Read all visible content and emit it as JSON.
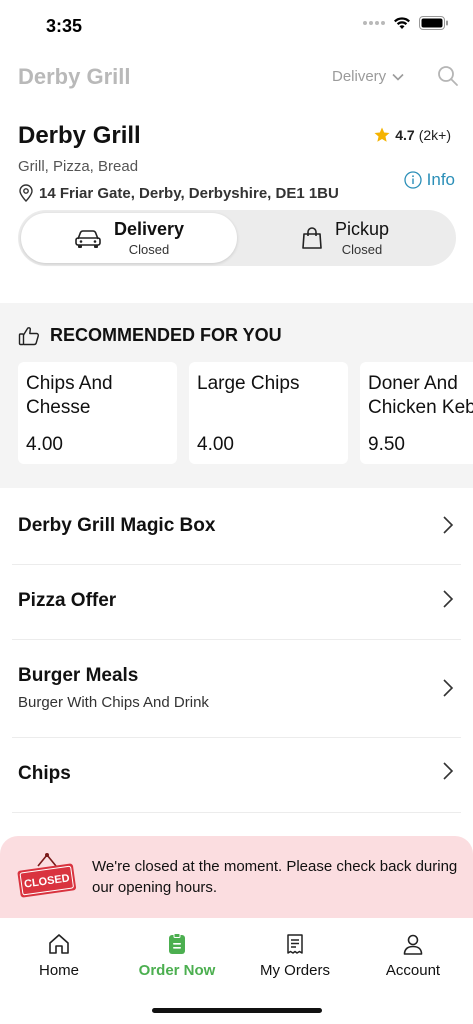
{
  "status_bar": {
    "time": "3:35"
  },
  "top_nav": {
    "title": "Derby Grill",
    "mode": "Delivery"
  },
  "restaurant": {
    "name": "Derby Grill",
    "rating": "4.7",
    "rating_count": "(2k+)",
    "cuisine": "Grill, Pizza, Bread",
    "address": "14 Friar Gate, Derby, Derbyshire, DE1 1BU",
    "info_label": "Info"
  },
  "order_mode": {
    "delivery": {
      "label": "Delivery",
      "status": "Closed"
    },
    "pickup": {
      "label": "Pickup",
      "status": "Closed"
    }
  },
  "recommended": {
    "title": "RECOMMENDED FOR YOU",
    "items": [
      {
        "name": "Chips And\nChesse",
        "price": "4.00"
      },
      {
        "name": "Large Chips",
        "price": "4.00"
      },
      {
        "name": "Doner And\nChicken Kebab",
        "price": "9.50"
      }
    ]
  },
  "categories": [
    {
      "title": "Derby Grill Magic Box",
      "subtitle": ""
    },
    {
      "title": "Pizza Offer",
      "subtitle": ""
    },
    {
      "title": "Burger Meals",
      "subtitle": "Burger With Chips And Drink"
    },
    {
      "title": "Chips",
      "subtitle": ""
    }
  ],
  "closed_banner": {
    "sign_text": "CLOSED",
    "message": "We're closed at the moment. Please check back during our opening hours."
  },
  "tabs": [
    {
      "label": "Home",
      "icon": "home-icon"
    },
    {
      "label": "Order Now",
      "icon": "order-icon"
    },
    {
      "label": "My Orders",
      "icon": "receipt-icon"
    },
    {
      "label": "Account",
      "icon": "person-icon"
    }
  ],
  "colors": {
    "accent_green": "#4caf50",
    "info_blue": "#2b8fb8",
    "banner_bg": "#fbdde0",
    "closed_red": "#d9333f",
    "star": "#f5b301"
  }
}
